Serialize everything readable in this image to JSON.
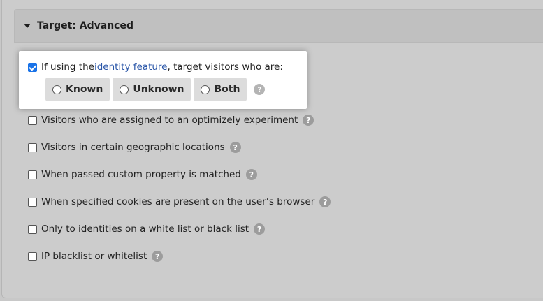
{
  "section": {
    "title": "Target: Advanced"
  },
  "identity": {
    "prefix": "If using the ",
    "link_text": "identity feature",
    "suffix": ", target visitors who are:",
    "checked": true,
    "options": [
      "Known",
      "Unknown",
      "Both"
    ],
    "help": "?"
  },
  "options": [
    {
      "label": "Visitors who are assigned to an optimizely experiment",
      "help": "?"
    },
    {
      "label": "Visitors in certain geographic locations",
      "help": "?"
    },
    {
      "label": "When passed custom property is matched",
      "help": "?"
    },
    {
      "label": "When specified cookies are present on the user’s browser",
      "help": "?"
    },
    {
      "label": "Only to identities on a white list or black list",
      "help": "?"
    },
    {
      "label": "IP blacklist or whitelist",
      "help": "?"
    }
  ]
}
